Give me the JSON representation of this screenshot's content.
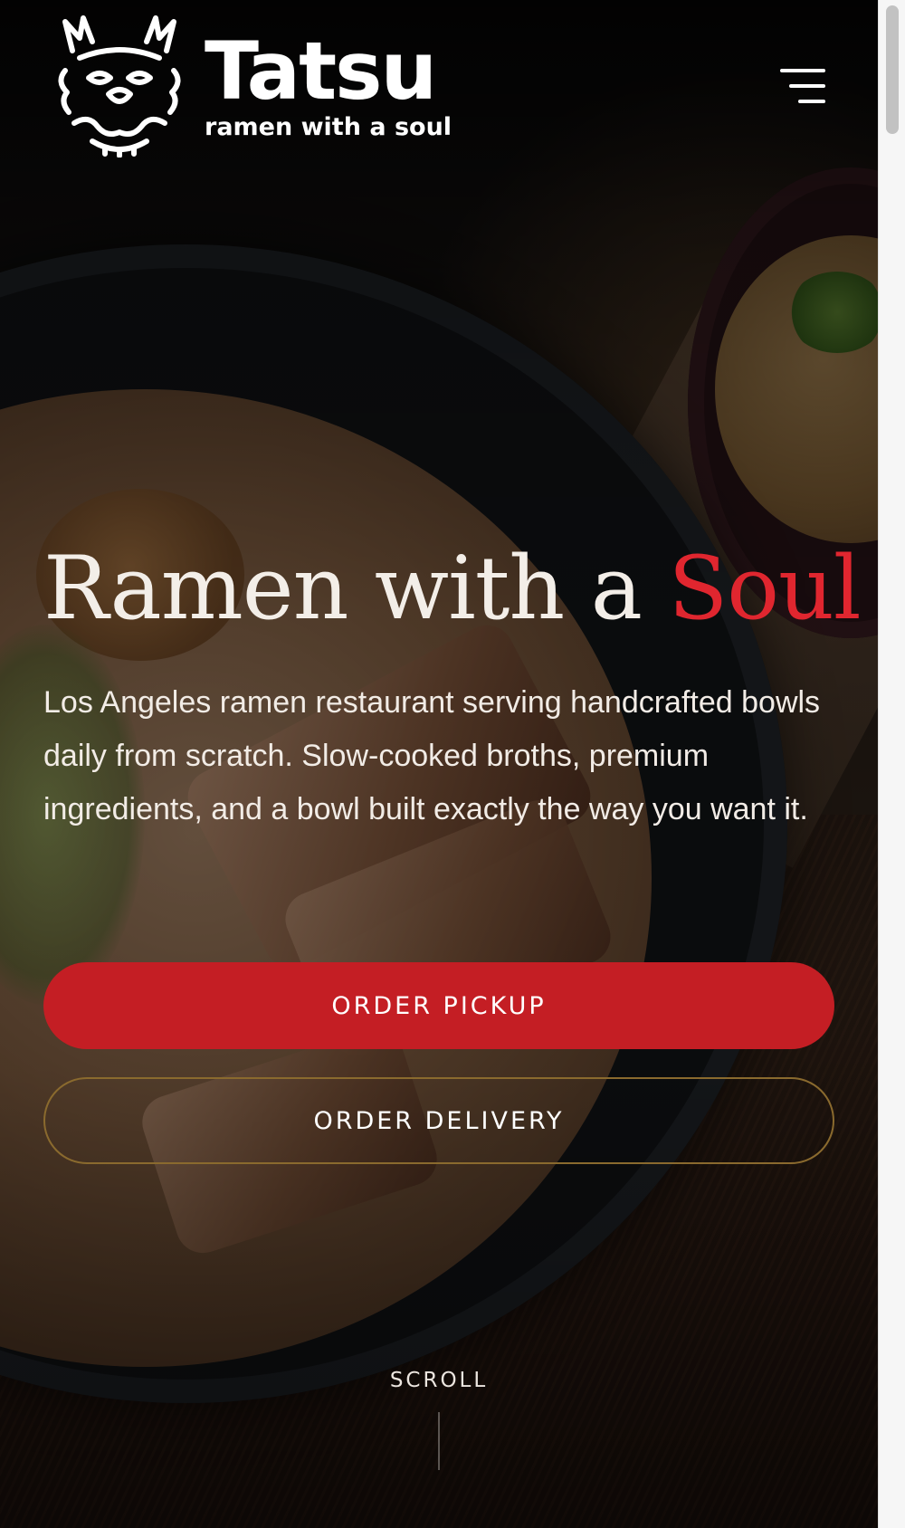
{
  "header": {
    "brand_name": "Tatsu",
    "brand_tagline": "ramen with a soul",
    "menu_icon": "hamburger-menu-icon",
    "logo_icon": "dragon-logo-icon"
  },
  "hero": {
    "title_main": "Ramen with a ",
    "title_accent": "Soul",
    "description": "Los Angeles ramen restaurant serving handcrafted bowls daily from scratch. Slow-cooked broths, premium ingredients, and a bowl built exactly the way you want it.",
    "primary_button": "ORDER PICKUP",
    "secondary_button": "ORDER DELIVERY",
    "scroll_label": "SCROLL"
  },
  "colors": {
    "accent": "#e0262f",
    "primary_button": "#c41e24",
    "secondary_border": "#8a6a2e",
    "text": "#f3eee8"
  }
}
